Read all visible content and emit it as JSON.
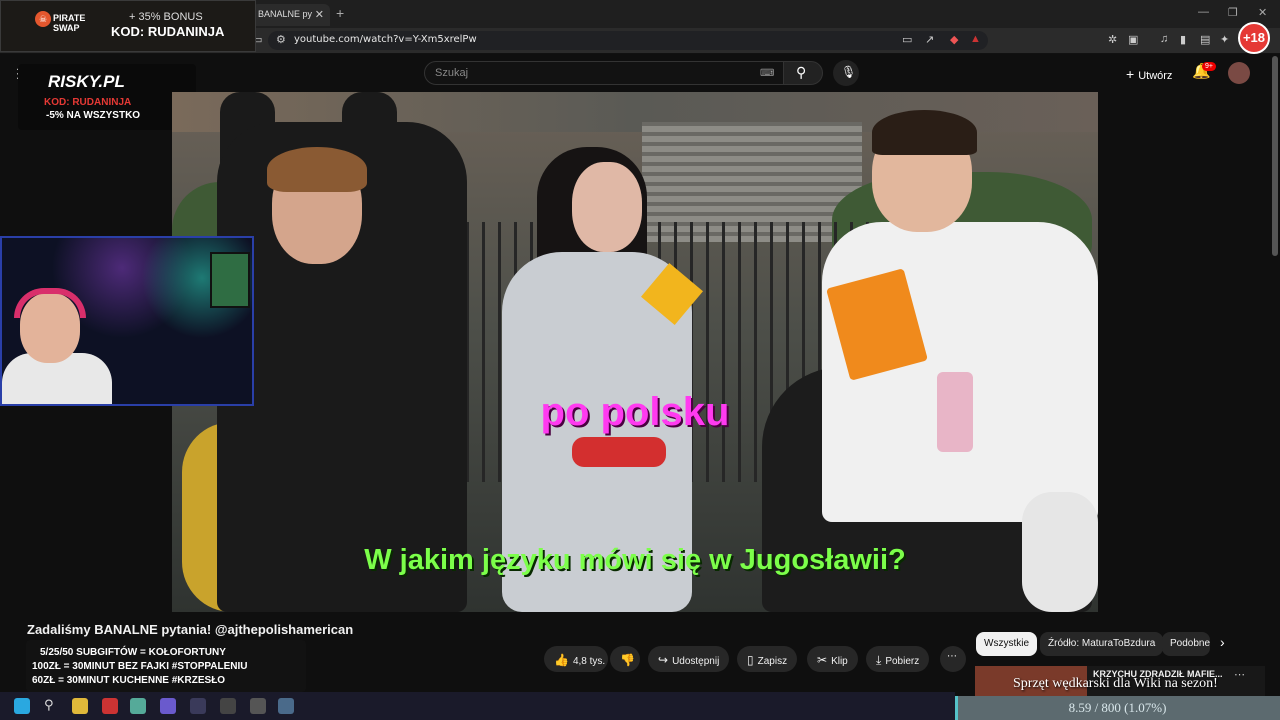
{
  "browser": {
    "tab_title": "BANALNE py",
    "url": "youtube.com/watch?v=Y-Xm5xrelPw"
  },
  "pirate_banner": {
    "logo": "PIRATE SWAP",
    "bonus": "+ 35% BONUS",
    "code": "KOD: RUDANINJA"
  },
  "risky_banner": {
    "brand": "RISKY.PL",
    "code": "KOD: RUDANINJA",
    "discount": "-5% NA WSZYSTKO"
  },
  "plus18": "+18",
  "header": {
    "search_placeholder": "Szukaj",
    "create_label": "Utwórz",
    "notif_badge": "9+"
  },
  "video": {
    "subtitle_top": "po polsku",
    "subtitle_bottom": "W jakim języku mówi się w Jugosławii?"
  },
  "video_title": "Zadaliśmy BANALNE pytania! @ajthepolishamerican",
  "actions": {
    "likes": "4,8 tys.",
    "share": "Udostępnij",
    "save": "Zapisz",
    "clip": "Klip",
    "download": "Pobierz"
  },
  "chips": [
    "Wszystkie",
    "Źródło: MaturaToBzdura",
    "Podobne"
  ],
  "related": {
    "title": "KRZYCHU ZDRADZIŁ MAFIE..."
  },
  "promo_lines": [
    "5/25/50 SUBGIFTÓW = KOŁOFORTUNY",
    "100ZŁ = 30MINUT BEZ FAJKI #STOPPALENIU",
    "60ZŁ = 30MINUT KUCHENNE #KRZESŁO"
  ],
  "stream_overlay": {
    "goal_text": "Sprzęt wędkarski dla Wiki na sezon!",
    "progress_text": "8.59 / 800 (1.07%)",
    "progress_fraction": 0.0107
  },
  "colors": {
    "subtitle_top": "#ff3af0",
    "subtitle_bottom": "#7cff4a",
    "accent_red": "#e53935"
  }
}
